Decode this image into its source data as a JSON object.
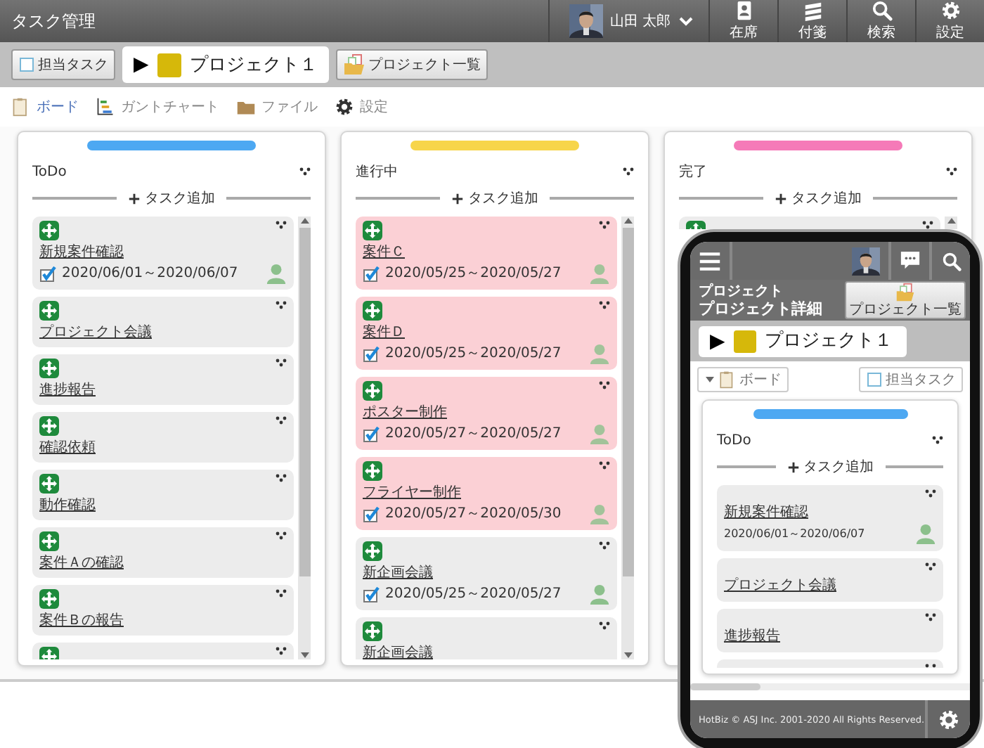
{
  "header": {
    "title": "タスク管理",
    "user": {
      "name": "山田 太郎"
    },
    "actions": [
      {
        "label": "在席",
        "kind": "presence"
      },
      {
        "label": "付箋",
        "kind": "notes"
      },
      {
        "label": "検索",
        "kind": "search"
      },
      {
        "label": "設定",
        "kind": "settings"
      }
    ]
  },
  "project_bar": {
    "my_tasks": "担当タスク",
    "marker": "▶",
    "project": "プロジェクト１",
    "project_list": "プロジェクト一覧"
  },
  "view_tabs": [
    {
      "label": "ボード",
      "kind": "board",
      "selected": true
    },
    {
      "label": "ガントチャート",
      "kind": "gantt",
      "selected": false
    },
    {
      "label": "ファイル",
      "kind": "files",
      "selected": false
    },
    {
      "label": "設定",
      "kind": "settings",
      "selected": false
    }
  ],
  "columns": [
    {
      "name": "ToDo",
      "color": "#4da8f2",
      "add_task": "タスク追加",
      "tasks": [
        {
          "title": "新規案件確認",
          "dates": "2020/06/01～2020/06/07",
          "assigned": true,
          "highlighted": false
        },
        {
          "title": "プロジェクト会議",
          "assigned": false,
          "highlighted": false
        },
        {
          "title": "進捗報告",
          "assigned": false,
          "highlighted": false
        },
        {
          "title": "確認依頼",
          "assigned": false,
          "highlighted": false
        },
        {
          "title": "動作確認",
          "assigned": false,
          "highlighted": false
        },
        {
          "title": "案件Ａの確認",
          "assigned": false,
          "highlighted": false
        },
        {
          "title": "案件Ｂの報告",
          "assigned": false,
          "highlighted": false
        },
        {
          "assigned": false,
          "highlighted": false
        }
      ]
    },
    {
      "name": "進行中",
      "color": "#f7d54a",
      "add_task": "タスク追加",
      "tasks": [
        {
          "title": "案件Ｃ",
          "dates": "2020/05/25～2020/05/27",
          "assigned": true,
          "highlighted": true
        },
        {
          "title": "案件Ｄ",
          "dates": "2020/05/25～2020/05/27",
          "assigned": true,
          "highlighted": true
        },
        {
          "title": "ポスター制作",
          "dates": "2020/05/27～2020/05/27",
          "assigned": true,
          "highlighted": true
        },
        {
          "title": "フライヤー制作",
          "dates": "2020/05/27～2020/05/30",
          "assigned": true,
          "highlighted": true
        },
        {
          "title": "新企画会議",
          "dates": "2020/05/25～2020/05/27",
          "assigned": true,
          "highlighted": false
        },
        {
          "title": "新企画会議",
          "assigned": false,
          "highlighted": false
        }
      ]
    },
    {
      "name": "完了",
      "color": "#f57ab8",
      "add_task": "タスク追加",
      "tasks": [
        {
          "assigned": false,
          "highlighted": false
        }
      ]
    }
  ],
  "mobile": {
    "section": "プロジェクト",
    "page_title": "プロジェクト詳細",
    "project_list": "プロジェクト一覧",
    "marker": "▶",
    "project": "プロジェクト１",
    "view": "ボード",
    "my_tasks": "担当タスク",
    "column": {
      "name": "ToDo",
      "color": "#4da8f2",
      "add_task": "タスク追加",
      "tasks": [
        {
          "title": "新規案件確認",
          "dates": "2020/06/01～2020/06/07",
          "assigned": true,
          "highlighted": false
        },
        {
          "title": "プロジェクト会議",
          "assigned": false,
          "highlighted": false
        },
        {
          "title": "進捗報告",
          "assigned": false,
          "highlighted": false
        },
        {
          "assigned": false,
          "highlighted": false
        }
      ]
    },
    "footer": "HotBiz © ASJ Inc. 2001-2020 All Rights Reserved."
  }
}
